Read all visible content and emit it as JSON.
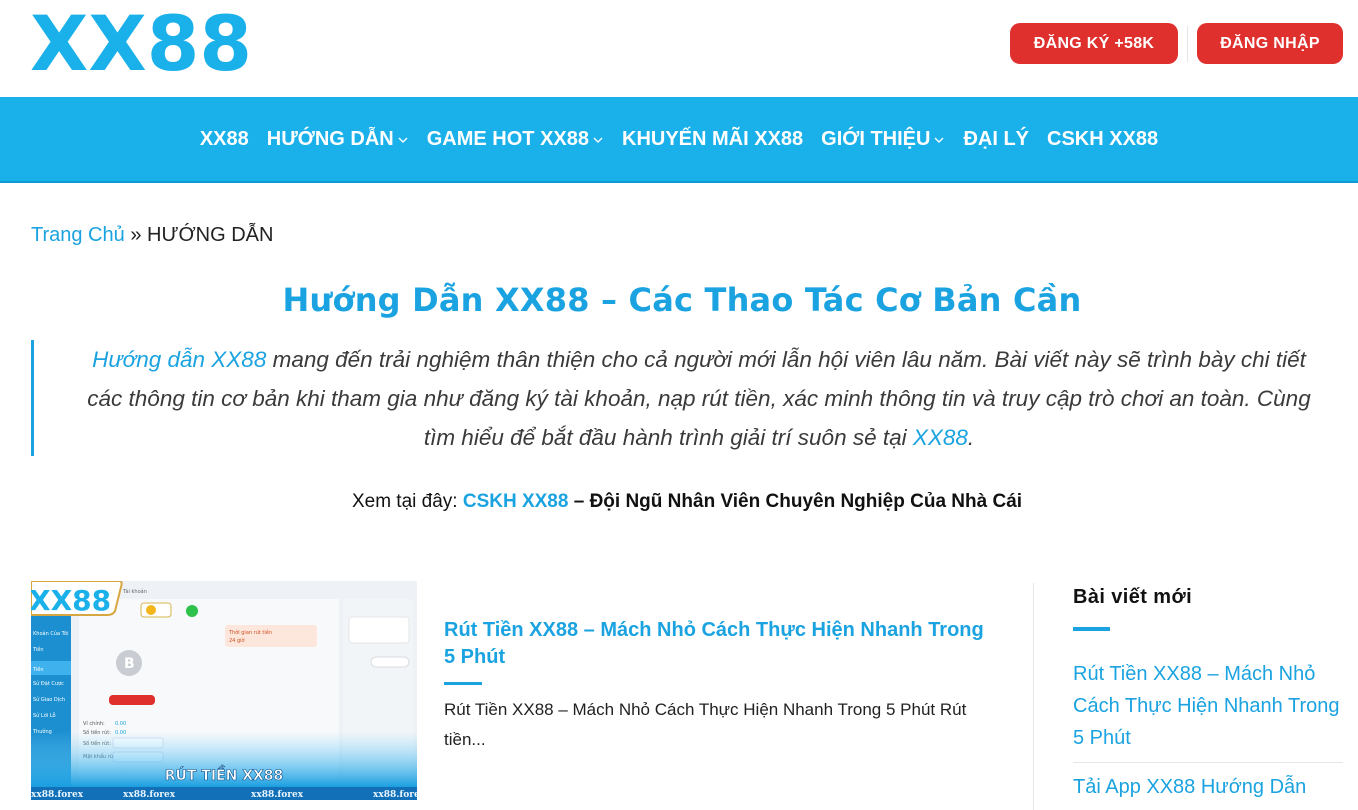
{
  "brand": {
    "logo_text": "XX88",
    "accent": "#1ab0ea",
    "button_red": "#e0302e"
  },
  "header": {
    "register_label": "ĐĂNG KÝ +58K",
    "login_label": "ĐĂNG NHẬP"
  },
  "nav": {
    "items": [
      {
        "label": "XX88",
        "has_dropdown": false
      },
      {
        "label": "HƯỚNG DẪN",
        "has_dropdown": true
      },
      {
        "label": "GAME HOT XX88",
        "has_dropdown": true
      },
      {
        "label": "KHUYẾN MÃI XX88",
        "has_dropdown": false
      },
      {
        "label": "GIỚI THIỆU",
        "has_dropdown": true
      },
      {
        "label": "ĐẠI LÝ",
        "has_dropdown": false
      },
      {
        "label": "CSKH XX88",
        "has_dropdown": false
      }
    ]
  },
  "breadcrumb": {
    "home": "Trang Chủ",
    "separator": "»",
    "current": "HƯỚNG DẪN"
  },
  "page": {
    "title": "Hướng Dẫn XX88 – Các Thao Tác Cơ Bản Cần",
    "intro_link": "Hướng dẫn XX88",
    "intro_text": " mang đến trải nghiệm thân thiện cho cả người mới lẫn hội viên lâu năm. Bài viết này sẽ trình bày chi tiết các thông tin cơ bản khi tham gia như đăng ký tài khoản, nạp rút tiền, xác minh thông tin và truy cập trò chơi an toàn. Cùng tìm hiểu để bắt đầu hành trình giải trí suôn sẻ tại ",
    "intro_link_2": "XX88",
    "intro_end": ".",
    "see_also_prefix": "Xem tại đây: ",
    "see_also_link": "CSKH XX88",
    "see_also_rest": " – Đội Ngũ Nhân Viên Chuyên Nghiệp Của Nhà Cái"
  },
  "post": {
    "title": "Rút Tiền XX88 – Mách Nhỏ Cách Thực Hiện Nhanh Trong 5 Phút",
    "excerpt": "Rút Tiền XX88 – Mách Nhỏ Cách Thực Hiện Nhanh Trong 5 Phút Rút tiền...",
    "thumb": {
      "logo": "XX88",
      "caption": "RÚT TIỀN XX88",
      "watermark": "xx88.forex"
    }
  },
  "sidebar": {
    "widget_title": "Bài viết mới",
    "recent": [
      "Rút Tiền XX88 – Mách Nhỏ Cách Thực Hiện Nhanh Trong 5 Phút",
      "Tải App XX88 Hướng Dẫn"
    ]
  }
}
